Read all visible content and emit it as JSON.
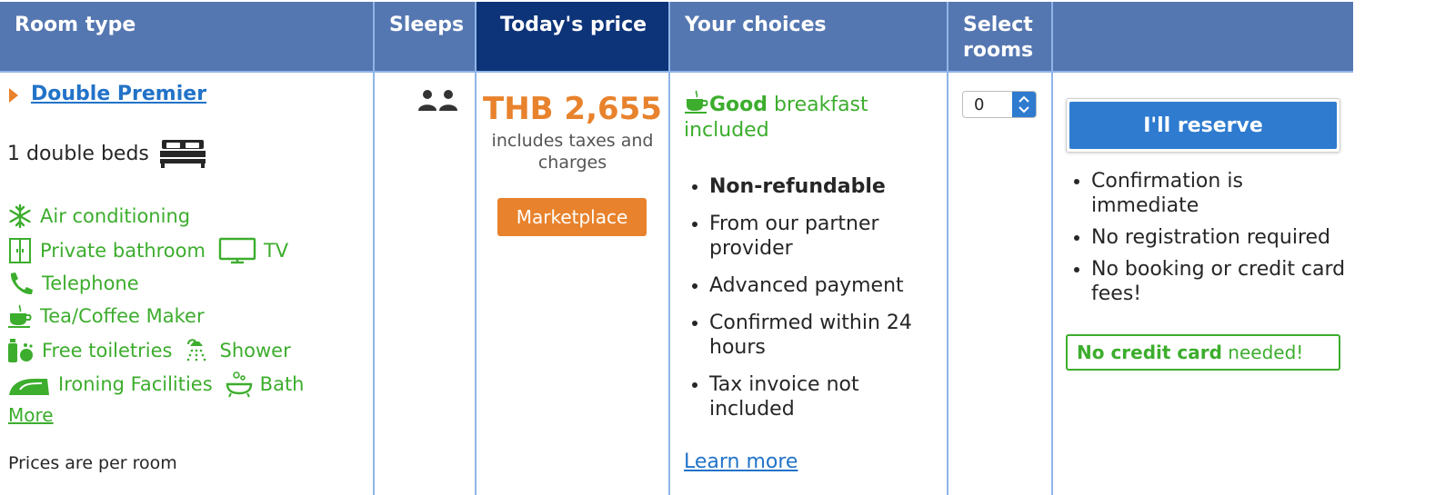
{
  "header": {
    "room_type": "Room type",
    "sleeps": "Sleeps",
    "price": "Today's price",
    "choices": "Your choices",
    "select_rooms_1": "Select",
    "select_rooms_2": "rooms"
  },
  "room": {
    "name": "Double Premier",
    "beds": "1 double beds",
    "facilities": {
      "aircon": "Air conditioning",
      "bathroom": "Private bathroom",
      "tv": "TV",
      "telephone": "Telephone",
      "tea": "Tea/Coffee Maker",
      "toiletries": "Free toiletries",
      "shower": "Shower",
      "ironing": "Ironing Facilities",
      "bath": "Bath"
    },
    "more_link": "More",
    "per_room_note": "Prices are per room"
  },
  "price": {
    "amount": "THB 2,655",
    "note_1": "includes taxes and",
    "note_2": "charges",
    "badge": "Marketplace"
  },
  "choices": {
    "breakfast_bold": "Good",
    "breakfast_rest": " breakfast",
    "breakfast_line2": "included",
    "items": [
      "Non-refundable",
      "From our partner provider",
      "Advanced payment",
      "Confirmed within 24 hours",
      "Tax invoice not included"
    ],
    "learn_more": "Learn more"
  },
  "select": {
    "value": "0"
  },
  "reserve": {
    "button": "I'll reserve",
    "benefits": [
      "Confirmation is immediate",
      "No registration required",
      "No booking or credit card fees!"
    ],
    "nocc_bold": "No credit card",
    "nocc_rest": " needed!"
  },
  "colors": {
    "header_bg": "#5577b1",
    "header_active_bg": "#0d3378",
    "price": "#e8822c",
    "green": "#3cad2d",
    "button": "#2e7bd0",
    "link": "#2273c8"
  }
}
